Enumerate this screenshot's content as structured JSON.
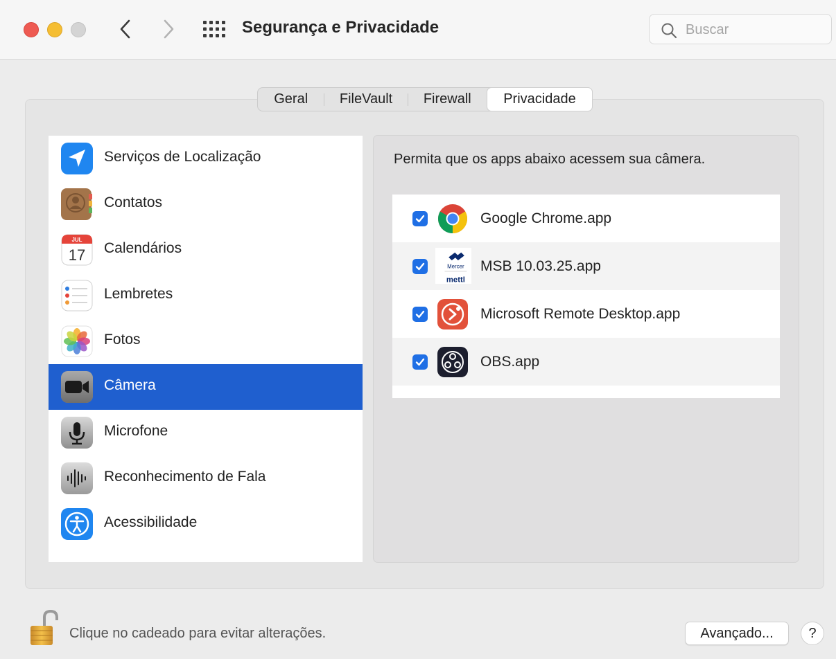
{
  "window": {
    "title": "Segurança e Privacidade",
    "search_placeholder": "Buscar"
  },
  "tabs": [
    {
      "label": "Geral"
    },
    {
      "label": "FileVault"
    },
    {
      "label": "Firewall"
    },
    {
      "label": "Privacidade",
      "selected": true
    }
  ],
  "sidebar": {
    "items": [
      {
        "label": "Serviços de Localização",
        "icon": "location-arrow-icon"
      },
      {
        "label": "Contatos",
        "icon": "contacts-icon"
      },
      {
        "label": "Calendários",
        "icon": "calendar-icon",
        "icon_month": "JUL",
        "icon_day": "17"
      },
      {
        "label": "Lembretes",
        "icon": "reminders-icon"
      },
      {
        "label": "Fotos",
        "icon": "photos-icon"
      },
      {
        "label": "Câmera",
        "icon": "camera-icon",
        "selected": true
      },
      {
        "label": "Microfone",
        "icon": "microphone-icon"
      },
      {
        "label": "Reconhecimento de Fala",
        "icon": "speech-waveform-icon"
      },
      {
        "label": "Acessibilidade",
        "icon": "accessibility-icon"
      }
    ]
  },
  "main": {
    "description": "Permita que os apps abaixo acessem sua câmera.",
    "apps": [
      {
        "name": "Google Chrome.app",
        "checked": true,
        "icon": "chrome-icon"
      },
      {
        "name": "MSB 10.03.25.app",
        "checked": true,
        "icon": "mercer-mettl-icon",
        "icon_text_top": "Mercer",
        "icon_text_bottom": "mettl"
      },
      {
        "name": "Microsoft Remote Desktop.app",
        "checked": true,
        "icon": "remote-desktop-icon"
      },
      {
        "name": "OBS.app",
        "checked": true,
        "icon": "obs-icon"
      }
    ]
  },
  "footer": {
    "lock_message": "Clique no cadeado para evitar alterações.",
    "advanced_label": "Avançado...",
    "help_label": "?"
  },
  "colors": {
    "selection": "#1f5fcf",
    "checkbox": "#1f6fe5",
    "close": "#ee5a52",
    "minimize": "#f5be33"
  }
}
